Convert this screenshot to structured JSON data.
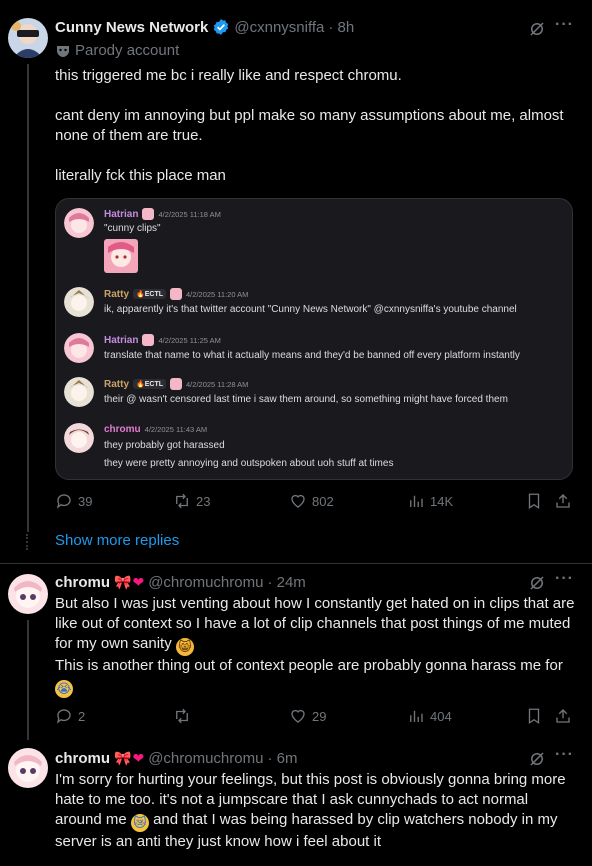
{
  "post1": {
    "name": "Cunny News Network",
    "handle": "@cxnnysniffa",
    "time": "· 8h",
    "parody_label": "Parody account",
    "lines": [
      "this triggered me bc i really like and respect chromu.",
      "cant deny im annoying but ppl make so many assumptions about me, almost none of them are true.",
      "literally fck this place man"
    ],
    "stats": {
      "replies": "39",
      "reposts": "23",
      "likes": "802",
      "views": "14K"
    }
  },
  "embed": {
    "messages": [
      {
        "name": "Hatrian",
        "name_color": "#c58ce0",
        "badge": "",
        "time": "4/2/2025 11:18 AM",
        "lines": [
          "\"cunny clips\""
        ]
      },
      {
        "name": "Ratty",
        "name_color": "#c9a46a",
        "badge": "🔥ECTL",
        "time": "4/2/2025 11:20 AM",
        "lines": [
          "ik, apparently it's that twitter account \"Cunny News Network\" @cxnnysniffa's youtube channel"
        ]
      },
      {
        "name": "Hatrian",
        "name_color": "#c58ce0",
        "badge": "",
        "time": "4/2/2025 11:25 AM",
        "lines": [
          "translate that name to what it actually means and they'd be banned off every platform instantly"
        ]
      },
      {
        "name": "Ratty",
        "name_color": "#c9a46a",
        "badge": "🔥ECTL",
        "time": "4/2/2025 11:28 AM",
        "lines": [
          "their @ wasn't censored last time i saw them around, so something might have forced them"
        ]
      },
      {
        "name": "chromu",
        "name_color": "#e27bd3",
        "badge": "",
        "time": "4/2/2025 11:43 AM",
        "lines": [
          "they probably got harassed",
          "they were pretty annoying and outspoken about uoh stuff at times"
        ]
      }
    ]
  },
  "show_more": "Show more replies",
  "post2": {
    "name": "chromu",
    "handle": "@chromuchromu",
    "time": "· 24m",
    "text1": "But also I was just venting about how I constantly get hated on in clips that are like out of context so I have a lot of clip channels that post things of me muted for my own sanity",
    "text2": "This is another thing out of context people are probably gonna harass me for",
    "stats": {
      "replies": "2",
      "reposts": "",
      "likes": "29",
      "views": "404"
    }
  },
  "post3": {
    "name": "chromu",
    "handle": "@chromuchromu",
    "time": "· 6m",
    "text1": "I'm sorry for hurting your feelings, but this post is obviously gonna bring more hate to me too. it's not a jumpscare that I ask cunnychads to act normal around me",
    "text2": "and that I was being harassed by clip watchers nobody in my server is an anti they just know how i feel about it"
  },
  "colors": {
    "accent": "#1d9bf0",
    "verified": "#1d9bf0",
    "background": "#000000"
  }
}
